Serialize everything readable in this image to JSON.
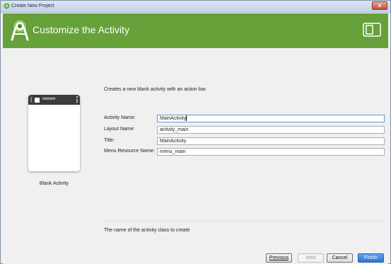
{
  "window": {
    "title": "Create New Project",
    "close_label": "x"
  },
  "header": {
    "title": "Customize the Activity"
  },
  "template": {
    "label": "Blank Activity",
    "toolbar_text": "-vvvvvvv"
  },
  "description": "Creates a new blank activity with an action bar.",
  "form": {
    "fields": [
      {
        "label": "Activity Name:",
        "value": "MainActivity"
      },
      {
        "label": "Layout Name:",
        "value": "activity_main"
      },
      {
        "label": "Title:",
        "value": "MainActivity"
      },
      {
        "label": "Menu Resource Name:",
        "value": "menu_main"
      }
    ]
  },
  "hint": "The name of the activity class to create",
  "buttons": {
    "previous": "Previous",
    "next": "Next",
    "cancel": "Cancel",
    "finish": "Finish"
  },
  "colors": {
    "header_green": "#66a13a",
    "primary_button": "#3b7fd9"
  }
}
